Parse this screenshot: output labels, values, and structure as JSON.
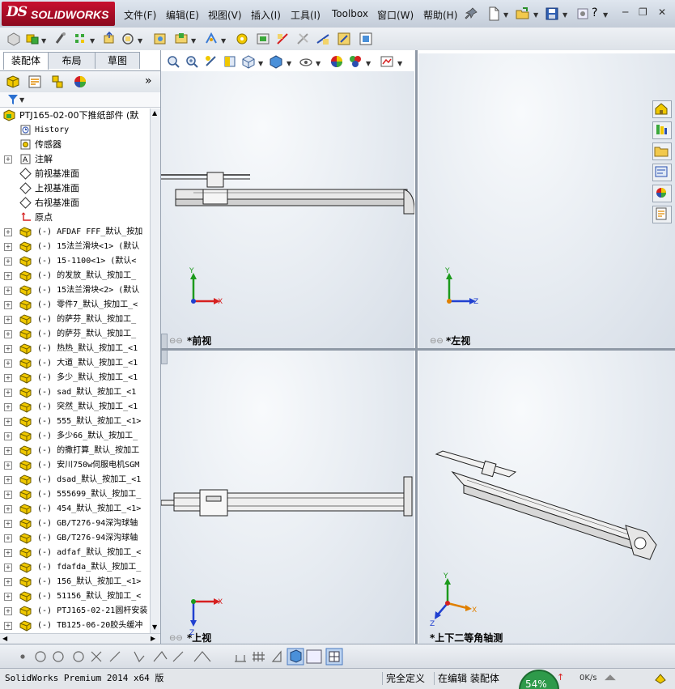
{
  "app": {
    "logo_ds": "DS",
    "logo_text": "SOLIDWORKS"
  },
  "menu": {
    "items": [
      "文件(F)",
      "编辑(E)",
      "视图(V)",
      "插入(I)",
      "工具(I)",
      "Toolbox",
      "窗口(W)",
      "帮助(H)"
    ]
  },
  "tabs": [
    {
      "label": "装配体",
      "active": true
    },
    {
      "label": "布局",
      "active": false
    },
    {
      "label": "草图",
      "active": false
    }
  ],
  "tree": {
    "root": "PTJ165-02-00下推纸部件  (默",
    "fixed_items": [
      {
        "label": "History",
        "mono": true
      },
      {
        "label": "传感器"
      },
      {
        "label": "注解",
        "expandable": true
      },
      {
        "label": "前视基准面"
      },
      {
        "label": "上视基准面"
      },
      {
        "label": "右视基准面"
      },
      {
        "label": "原点"
      }
    ],
    "components": [
      "(-) AFDAF FFF_默认_按加",
      "(-) 15法兰滑块<1> (默认",
      "(-) 15-1100<1> (默认<",
      "(-) 的发放_默认_按加工_",
      "(-) 15法兰滑块<2> (默认",
      "(-) 零件7_默认_按加工_<",
      "(-) 的萨芬_默认_按加工_",
      "(-) 的萨芬_默认_按加工_",
      "(-) 热热_默认_按加工_<1",
      "(-) 大道_默认_按加工_<1",
      "(-) 多少_默认_按加工_<1",
      "(-) sad_默认_按加工_<1",
      "(-) 突然_默认_按加工_<1",
      "(-) 555_默认_按加工_<1>",
      "(-) 多少66_默认_按加工_",
      "(-) 的撒打算_默认_按加工",
      "(-) 安川750w伺服电机SGM",
      "(-) dsad_默认_按加工_<1",
      "(-) 555699_默认_按加工_",
      "(-) 454_默认_按加工_<1>",
      "(-) GB/T276-94深沟球轴",
      "(-) GB/T276-94深沟球轴",
      "(-) adfaf_默认_按加工_<",
      "(-) fdafda_默认_按加工_",
      "(-) 156_默认_按加工_<1>",
      "(-) 51156_默认_按加工_<",
      "(-) PTJ165-02-21圆杆安装",
      "(-) TB125-06-20胶头缓冲"
    ]
  },
  "viewports": [
    {
      "label": "*前视",
      "axes": [
        "Y",
        "X"
      ]
    },
    {
      "label": "*左视",
      "axes": [
        "Y",
        "Z"
      ]
    },
    {
      "label": "*上视",
      "axes": [
        "Z",
        "X"
      ]
    },
    {
      "label": "*上下二等角轴测",
      "axes": [
        "Y",
        "Z",
        "X"
      ]
    }
  ],
  "status": {
    "product": "SolidWorks Premium 2014 x64 版",
    "state": "完全定义",
    "mode": "在编辑 装配体"
  },
  "netmeter": {
    "percent": "54%",
    "speed": "0K/s"
  },
  "colors": {
    "accent": "#c8102e",
    "axis_x": "#d62020",
    "axis_y": "#1c9a1c",
    "axis_z": "#2040d0",
    "component_icon": "#f0c800"
  }
}
